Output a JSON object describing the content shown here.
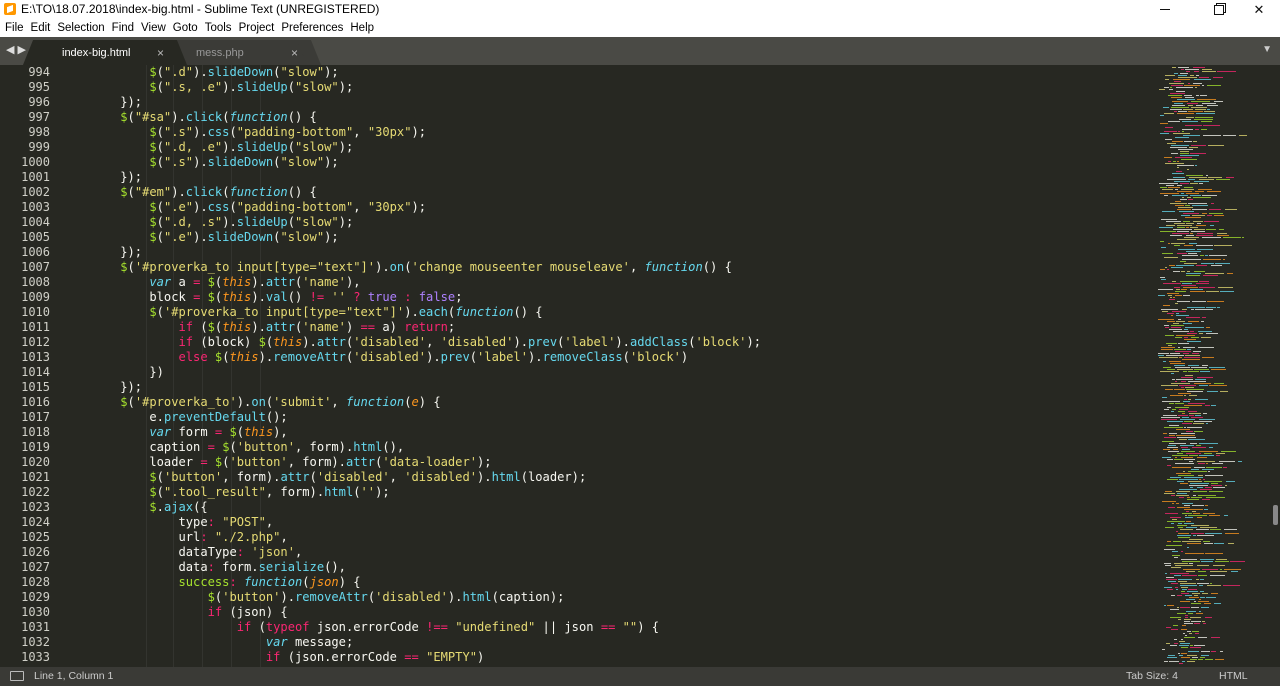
{
  "window": {
    "title": "E:\\TO\\18.07.2018\\index-big.html - Sublime Text (UNREGISTERED)",
    "min_glyph": "—",
    "max_glyph": "☐",
    "close_glyph": "✕"
  },
  "menu": [
    "File",
    "Edit",
    "Selection",
    "Find",
    "View",
    "Goto",
    "Tools",
    "Project",
    "Preferences",
    "Help"
  ],
  "tabbar": {
    "nav_arrows": "◀▶",
    "tabs": [
      {
        "label": "index-big.html",
        "close": "×",
        "active": true
      },
      {
        "label": "mess.php",
        "close": "×",
        "active": false
      }
    ],
    "menu_icon": "▼"
  },
  "editor": {
    "line_numbers": [
      994,
      995,
      996,
      997,
      998,
      999,
      1000,
      1001,
      1002,
      1003,
      1004,
      1005,
      1006,
      1007,
      1008,
      1009,
      1010,
      1011,
      1012,
      1013,
      1014,
      1015,
      1016,
      1017,
      1018,
      1019,
      1020,
      1021,
      1022,
      1023,
      1024,
      1025,
      1026,
      1027,
      1028,
      1029,
      1030,
      1031,
      1032,
      1033
    ],
    "theme_colors": {
      "background": "#272822",
      "string": "#e6db74",
      "keyword": "#f92672",
      "function": "#a6e22e",
      "storage": "#66d9ef",
      "param": "#fd971f",
      "constant": "#ae81ff"
    },
    "lines": [
      "            $(\".d\").slideDown(\"slow\");",
      "            $(\".s, .e\").slideUp(\"slow\");",
      "        });",
      "        $(\"#sa\").click(function() {",
      "            $(\".s\").css(\"padding-bottom\", \"30px\");",
      "            $(\".d, .e\").slideUp(\"slow\");",
      "            $(\".s\").slideDown(\"slow\");",
      "        });",
      "        $(\"#em\").click(function() {",
      "            $(\".e\").css(\"padding-bottom\", \"30px\");",
      "            $(\".d, .s\").slideUp(\"slow\");",
      "            $(\".e\").slideDown(\"slow\");",
      "        });",
      "        $('#proverka_to input[type=\"text\"]').on('change mouseenter mouseleave', function() {",
      "            var a = $(this).attr('name'),",
      "            block = $(this).val() != '' ? true : false;",
      "            $('#proverka_to input[type=\"text\"]').each(function() {",
      "                if ($(this).attr('name') == a) return;",
      "                if (block) $(this).attr('disabled', 'disabled').prev('label').addClass('block');",
      "                else $(this).removeAttr('disabled').prev('label').removeClass('block')",
      "            })",
      "        });",
      "        $('#proverka_to').on('submit', function(e) {",
      "            e.preventDefault();",
      "            var form = $(this),",
      "            caption = $('button', form).html(),",
      "            loader = $('button', form).attr('data-loader');",
      "            $('button', form).attr('disabled', 'disabled').html(loader);",
      "            $(\".tool_result\", form).html('');",
      "            $.ajax({",
      "                type: \"POST\",",
      "                url: \"./2.php\",",
      "                dataType: 'json',",
      "                data: form.serialize(),",
      "                success: function(json) {",
      "                    $('button').removeAttr('disabled').html(caption);",
      "                    if (json) {",
      "                        if (typeof json.errorCode !== \"undefined\" || json == \"\") {",
      "                            var message;",
      "                            if (json.errorCode == \"EMPTY\")"
    ]
  },
  "status": {
    "position": "Line 1, Column 1",
    "tab_size": "Tab Size: 4",
    "syntax": "HTML"
  }
}
